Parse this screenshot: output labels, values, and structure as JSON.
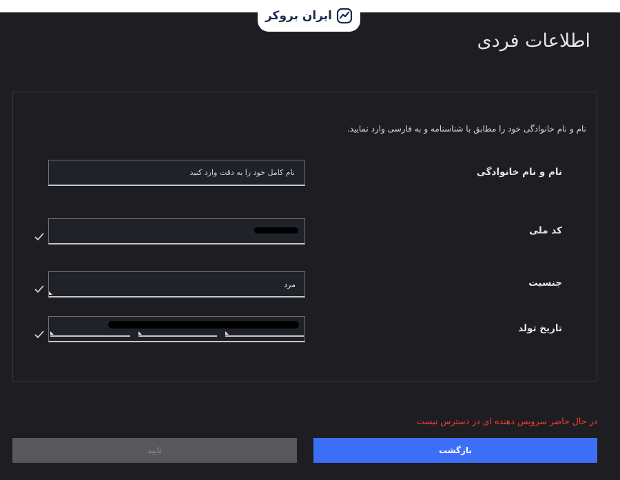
{
  "brand": {
    "name": "ایران بروکر",
    "accent": "#3d6ef7"
  },
  "page": {
    "title": "اطلاعات فردی"
  },
  "form": {
    "instructions": "نام و نام خانوادگی خود را مطابق با شناسنامه و به فارسی وارد نمایید.",
    "full_name": {
      "label": "نام و نام خانوادگی",
      "placeholder": "نام کامل خود را به دقت وارد کنید",
      "value": ""
    },
    "national_code": {
      "label": "کد ملی"
    },
    "gender": {
      "label": "جنسیت",
      "value": "مرد"
    },
    "birth_date": {
      "label": "تاریخ تولد"
    }
  },
  "status": {
    "error": "در حال حاضر سرویس دهنده ای در دسترس نیست",
    "error_color": "#ff3b30"
  },
  "actions": {
    "back_label": "بازگشت",
    "confirm_label": "تایید"
  },
  "icons": {
    "logo": "chart-trend-icon",
    "valid": "checkmark-icon"
  }
}
